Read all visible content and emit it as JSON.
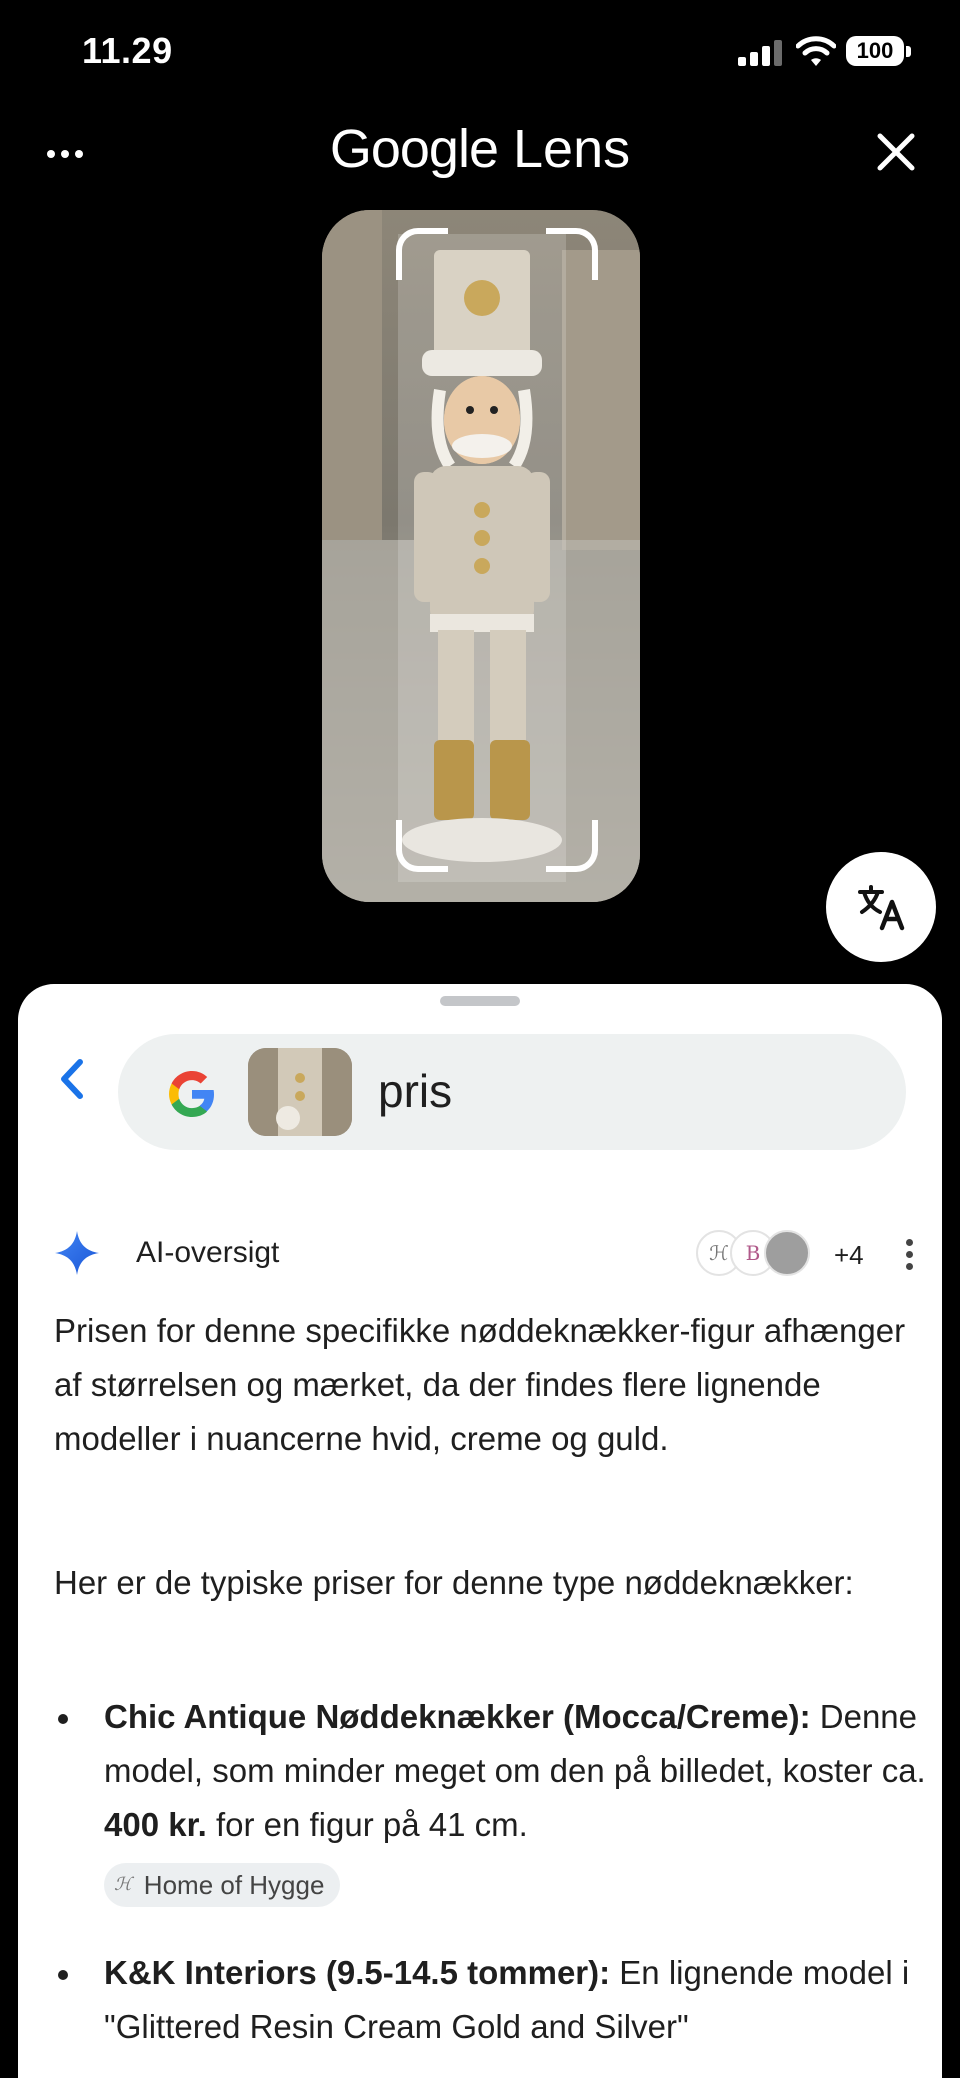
{
  "status_bar": {
    "time": "11.29",
    "battery": "100"
  },
  "header": {
    "title_brand": "Google",
    "title_product": "Lens"
  },
  "search": {
    "query": "pris"
  },
  "ai_overview": {
    "title": "AI-oversigt",
    "sources_more": "+4",
    "paragraph_1": "Prisen for denne specifikke nøddeknækker-figur afhænger af størrelsen og mærket, da der findes flere lignende modeller i nuancerne hvid, creme og guld.",
    "paragraph_2": "Her er de typiske priser for denne type nøddeknækker:",
    "bullets": [
      {
        "title": "Chic Antique Nøddeknækker (Mocca/Creme):",
        "text_before": "Denne model, som minder meget om den på billedet, koster ca.",
        "price": "400 kr.",
        "text_after": "for en figur på 41 cm.",
        "source": "Home of Hygge"
      },
      {
        "title": "K&K Interiors (9.5-14.5 tommer):",
        "text": "En lignende model i \"Glittered Resin Cream Gold and Silver\""
      }
    ]
  },
  "colors": {
    "google_blue": "#4285F4",
    "google_red": "#EA4335",
    "google_yellow": "#FBBC05",
    "google_green": "#34A853",
    "back_arrow": "#1a73e8"
  }
}
